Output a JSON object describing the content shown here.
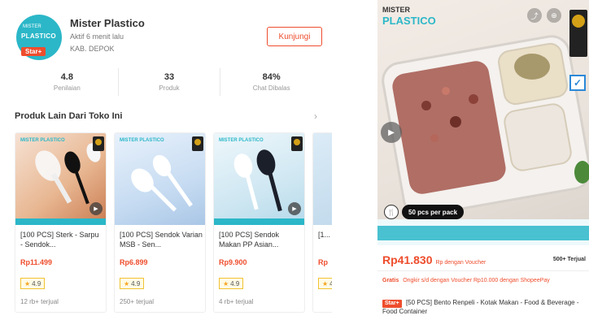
{
  "shop": {
    "name": "Mister Plastico",
    "logo_text": "PLASTICO",
    "logo_top": "MISTER",
    "star_badge": "Star+",
    "subtitle_1": "Aktif 6 menit lalu",
    "subtitle_2": "KAB. DEPOK",
    "visit_label": "Kunjungi"
  },
  "stats": [
    {
      "value": "4.8",
      "label": "Penilaian"
    },
    {
      "value": "33",
      "label": "Produk"
    },
    {
      "value": "84%",
      "label": "Chat Dibalas"
    }
  ],
  "section": {
    "title": "Produk Lain Dari Toko Ini",
    "chevron": "›"
  },
  "products": [
    {
      "title": "[100 PCS] Sterk - Sarpu - Sendok...",
      "price": "Rp11.499",
      "rating": "4.9",
      "sold": "12 rb+ terjual",
      "brand": "MISTER PLASTICO"
    },
    {
      "title": "[100 PCS] Sendok Varian MSB - Sen...",
      "price": "Rp6.899",
      "rating": "4.9",
      "sold": "250+ terjual",
      "brand": "MISTER PLASTICO"
    },
    {
      "title": "[100 PCS] Sendok Makan PP Asian...",
      "price": "Rp9.900",
      "rating": "4.9",
      "sold": "4 rb+ terjual",
      "brand": "MISTER PLASTICO"
    },
    {
      "title": "[1...",
      "price": "Rp",
      "rating": "4",
      "sold": "",
      "brand": ""
    }
  ],
  "detail": {
    "brand_top": "MISTER",
    "brand": "PLASTICO",
    "pack_label": "50 pcs per pack",
    "price": "Rp41.830",
    "price_note": "Rp dengan Voucher",
    "sold": "500+ Terjual",
    "promo_tag": "Gratis",
    "promo_text": "Ongkir s/d dengan Voucher Rp10.000 dengan ShopeePay",
    "star_tag": "Star+",
    "description": "[50 PCS] Bento Renpeli - Kotak Makan - Food & Beverage - Food Container"
  },
  "colors": {
    "accent": "#ee4d2d",
    "brand": "#2bb7c8"
  }
}
